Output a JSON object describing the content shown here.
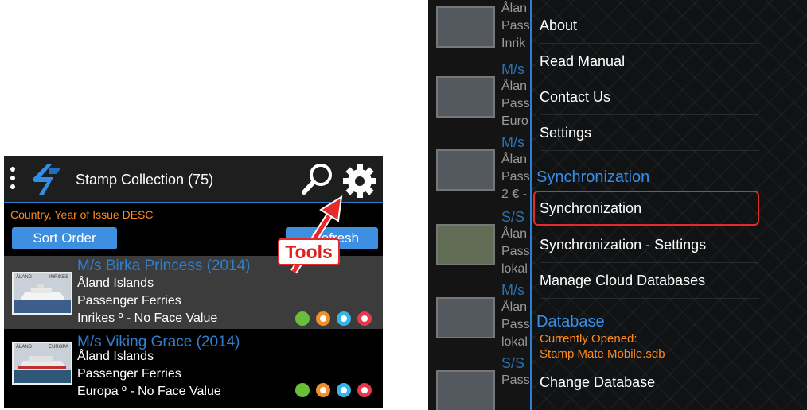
{
  "left_panel": {
    "app_title": "Stamp Collection (75)",
    "icons": {
      "menu": "kebab-menu-icon",
      "logo": "app-logo-icon",
      "search": "search-icon",
      "tools": "gear-icon"
    },
    "sort_info": "Country, Year of Issue DESC",
    "sort_button": "Sort Order",
    "refresh_button": "Refresh",
    "callout_label": "Tools",
    "items": [
      {
        "title": "M/s Birka Princess (2014)",
        "country": "Åland Islands",
        "topic": "Passenger Ferries",
        "detail": "Inrikes º - No Face Value",
        "thumb_left": "ÅLAND",
        "thumb_right": "INRIKES"
      },
      {
        "title": "M/s Viking Grace (2014)",
        "country": "Åland Islands",
        "topic": "Passenger Ferries",
        "detail": "Europa º - No Face Value",
        "thumb_left": "ÅLAND",
        "thumb_right": "EUROPA"
      }
    ],
    "status_colors": [
      "#6abf3a",
      "#f0902a",
      "#35b5e8",
      "#e8384a"
    ]
  },
  "right_panel": {
    "background_rows": [
      {
        "lines": [
          "Ålan",
          "Pass",
          "Inrik"
        ],
        "title": ""
      },
      {
        "title": "M/s",
        "lines": [
          "Ålan",
          "Pass",
          "Euro"
        ]
      },
      {
        "title": "M/s",
        "lines": [
          "Ålan",
          "Pass",
          "2 € -"
        ]
      },
      {
        "title": "S/S",
        "lines": [
          "Ålan",
          "Pass",
          "lokal"
        ]
      },
      {
        "title": "M/s",
        "lines": [
          "Ålan",
          "Pass",
          "lokal"
        ]
      },
      {
        "title": "S/S",
        "lines": [
          "Pass"
        ]
      }
    ],
    "menu": {
      "about": "About",
      "read_manual": "Read Manual",
      "contact_us": "Contact Us",
      "settings": "Settings",
      "sync_header": "Synchronization",
      "synchronization": "Synchronization",
      "sync_settings": "Synchronization - Settings",
      "manage_cloud": "Manage Cloud Databases",
      "db_header": "Database",
      "currently_opened_label": "Currently Opened:",
      "currently_opened_file": "Stamp Mate Mobile.sdb",
      "change_db": "Change Database"
    }
  }
}
